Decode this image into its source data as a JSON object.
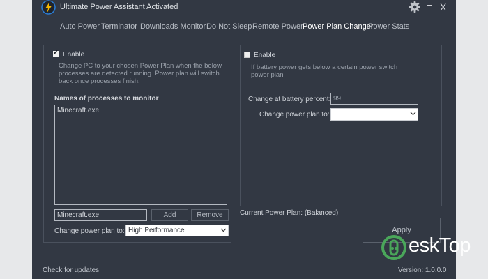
{
  "window": {
    "title": "Ultimate Power Assistant Activated",
    "min_glyph": "–",
    "close_glyph": "X"
  },
  "tabs": [
    {
      "label": "Auto Power"
    },
    {
      "label": "Terminator"
    },
    {
      "label": "Downloads Monitor"
    },
    {
      "label": "Do Not Sleep"
    },
    {
      "label": "Remote Power"
    },
    {
      "label": "Power Plan Changer",
      "active": true
    },
    {
      "label": "Power Stats"
    }
  ],
  "process_panel": {
    "enable_label": "Enable",
    "enabled": true,
    "description": "Change PC to your chosen Power Plan when the below processes are detected running. Power plan will switch back once processes finish.",
    "list_header": "Names of processes to monitor",
    "processes": [
      "Minecraft.exe"
    ],
    "input_value": "Minecraft.exe",
    "add_label": "Add",
    "remove_label": "Remove",
    "plan_label": "Change power plan to:",
    "plan_value": "High Performance"
  },
  "battery_panel": {
    "enable_label": "Enable",
    "enabled": false,
    "description": "If battery power gets below a certain power switch power plan",
    "percent_label": "Change at battery percent:",
    "percent_value": "99",
    "plan_label": "Change power plan to:",
    "plan_value": ""
  },
  "current_plan": "Current Power Plan: (Balanced)",
  "apply_label": "Apply",
  "footer": {
    "updates": "Check for updates",
    "version": "Version: 1.0.0.0"
  },
  "watermark": {
    "text": "eskTop"
  },
  "colors": {
    "window_bg": "#323843",
    "accent_logo": "#f5b800",
    "logo_ring": "#2a7ad0",
    "watermark_icon": "#4aa65a"
  },
  "icons": {
    "app": "lightning-bolt-icon",
    "settings": "gear-icon",
    "dropdown": "chevron-down-icon",
    "watermark": "power-d-icon"
  }
}
